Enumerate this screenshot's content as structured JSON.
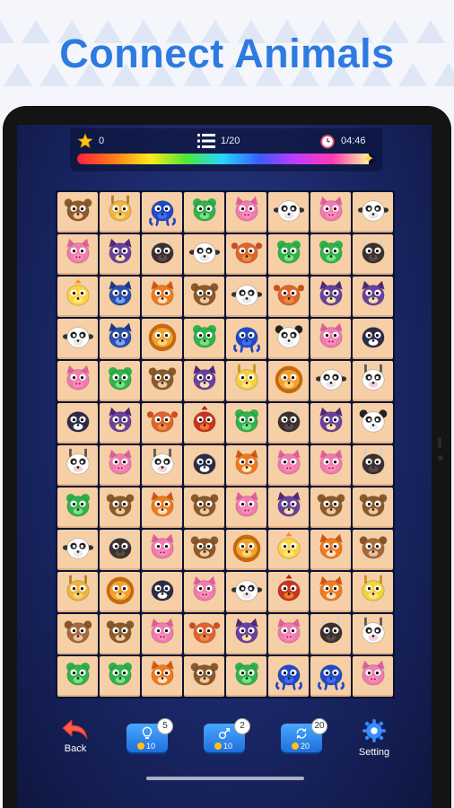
{
  "title": "Connect Animals",
  "colors": {
    "title": "#2e7be0",
    "tile": "#f7cfa6"
  },
  "hud": {
    "score": "0",
    "score_icon": "star-icon",
    "level": "1/20",
    "level_icon": "list-icon",
    "timer": "04:46",
    "timer_icon": "clock-icon",
    "time_progress": 0.98
  },
  "board": {
    "rows": 12,
    "cols": 8,
    "tiles": [
      [
        "monkey",
        "giraffe",
        "octopus",
        "frog",
        "pig",
        "sheep",
        "pig",
        "sheep"
      ],
      [
        "pig",
        "owl",
        "buffalo",
        "sheep",
        "crab",
        "frog",
        "frog",
        "buffalo"
      ],
      [
        "chick",
        "cat",
        "fox",
        "monkey",
        "sheep",
        "crab",
        "owl",
        "owl"
      ],
      [
        "sheep",
        "cat",
        "lion",
        "frog",
        "octopus",
        "panda",
        "pig",
        "penguin"
      ],
      [
        "pig",
        "frog",
        "monkey",
        "owl",
        "deer",
        "lion",
        "sheep",
        "cow"
      ],
      [
        "penguin",
        "owl",
        "crab",
        "rooster",
        "frog",
        "buffalo",
        "owl",
        "panda"
      ],
      [
        "cow",
        "pig",
        "cow",
        "penguin",
        "fox",
        "pig",
        "pig",
        "buffalo"
      ],
      [
        "frog",
        "monkey",
        "fox",
        "monkey",
        "pig",
        "owl",
        "monkey",
        "monkey"
      ],
      [
        "sheep",
        "buffalo",
        "pig",
        "monkey",
        "lion",
        "chick",
        "fox",
        "bear"
      ],
      [
        "giraffe",
        "lion",
        "penguin",
        "pig",
        "sheep",
        "rooster",
        "fox",
        "deer"
      ],
      [
        "bear",
        "monkey",
        "pig",
        "crab",
        "owl",
        "pig",
        "buffalo",
        "cow"
      ],
      [
        "frog",
        "frog",
        "fox",
        "monkey",
        "frog",
        "octopus",
        "octopus",
        "pig"
      ]
    ]
  },
  "controls": {
    "back": {
      "label": "Back",
      "icon": "back-arrow-icon"
    },
    "hint": {
      "icon": "lightbulb-icon",
      "count": "5",
      "cost": "10"
    },
    "swap": {
      "icon": "swap-icon",
      "count": "2",
      "cost": "10"
    },
    "shuffle": {
      "icon": "shuffle-icon",
      "count": "20",
      "cost": "20"
    },
    "setting": {
      "label": "Setting",
      "icon": "gear-icon"
    }
  }
}
